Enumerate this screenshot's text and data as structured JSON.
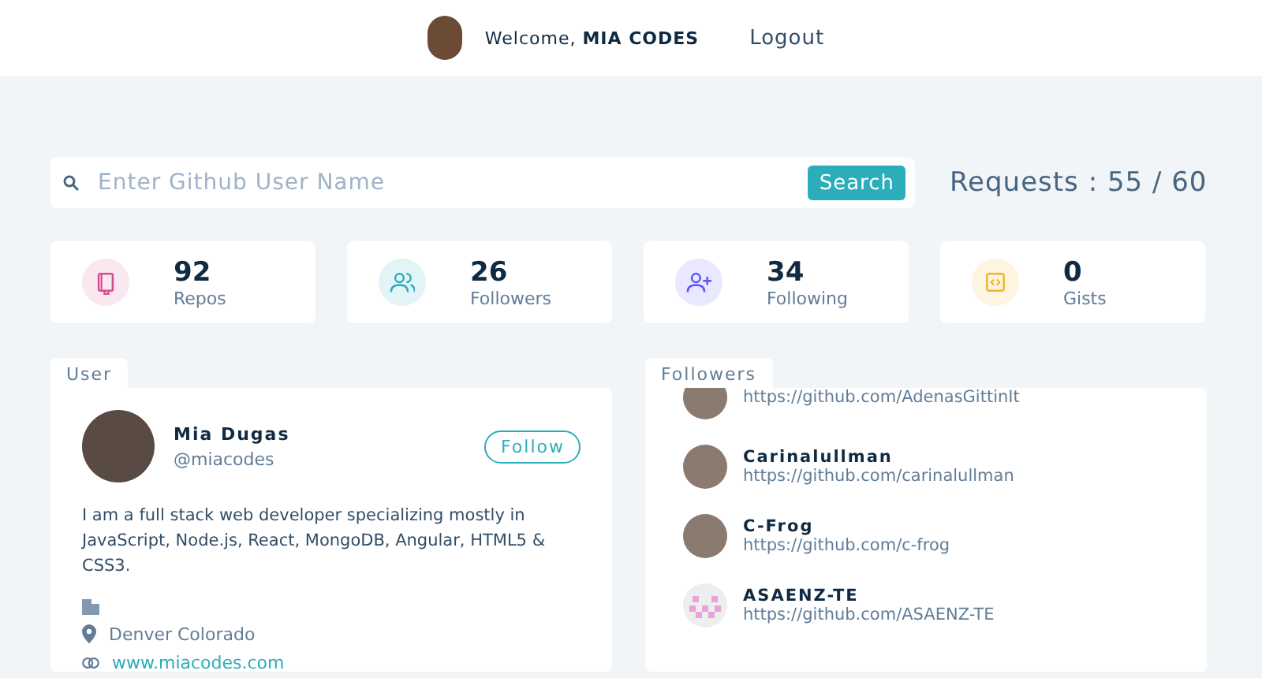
{
  "header": {
    "greeting": "Welcome, **MIA CODES**",
    "logout": "Logout"
  },
  "search": {
    "placeholder": "Enter Github User Name",
    "button": "Search",
    "requests": "Requests : 55 / 60"
  },
  "stats": [
    {
      "kind": "repos",
      "value": "92",
      "label": "Repos",
      "color": "#da4a91"
    },
    {
      "kind": "followers",
      "value": "26",
      "label": "Followers",
      "color": "#2caeba"
    },
    {
      "kind": "following",
      "value": "34",
      "label": "Following",
      "color": "#5d55fa"
    },
    {
      "kind": "gists",
      "value": "0",
      "label": "Gists",
      "color": "#f0b429"
    }
  ],
  "user": {
    "tab": "User",
    "name": "Mia Dugas",
    "handle": "@miacodes",
    "follow": "Follow",
    "bio": "I am a full stack web developer specializing mostly in JavaScript, Node.js, React, MongoDB, Angular, HTML5 & CSS3.",
    "location": "Denver Colorado",
    "website": "www.miacodes.com"
  },
  "followers": {
    "tab": "Followers",
    "items": [
      {
        "url": "https://github.com/AdenasGittinIt"
      },
      {
        "name": "Carinalullman",
        "url": "https://github.com/carinalullman"
      },
      {
        "name": "C-Frog",
        "url": "https://github.com/c-frog"
      },
      {
        "name": "ASAENZ-TE",
        "url": "https://github.com/ASAENZ-TE",
        "kind": "identicon"
      }
    ]
  }
}
